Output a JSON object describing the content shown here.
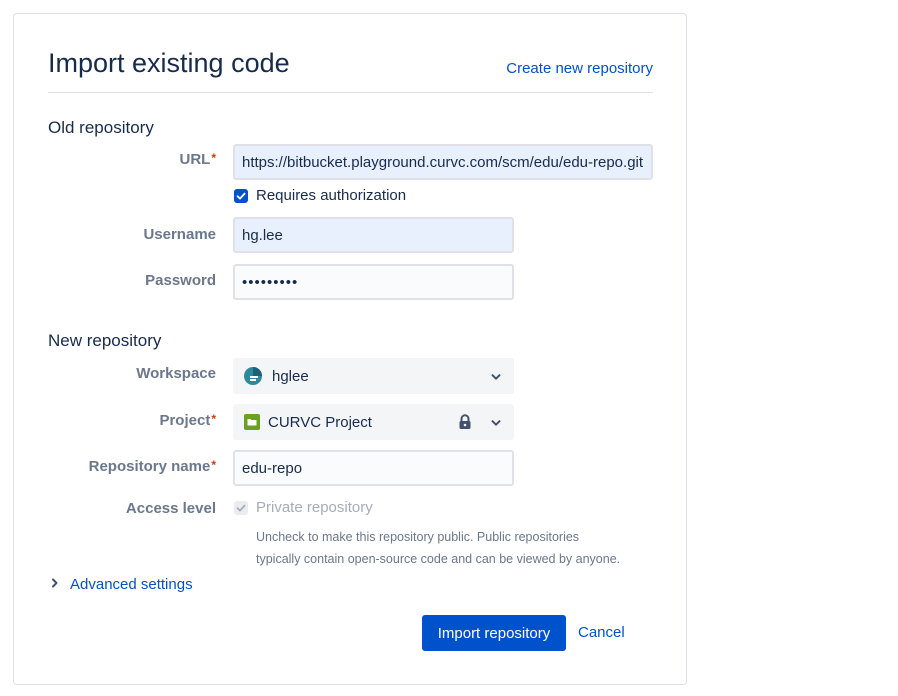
{
  "header": {
    "title": "Import existing code",
    "create_link": "Create new repository"
  },
  "old_repo": {
    "section_title": "Old repository",
    "url": {
      "label": "URL",
      "required_mark": "*",
      "value": "https://bitbucket.playground.curvc.com/scm/edu/edu-repo.git"
    },
    "requires_auth": {
      "label": "Requires authorization",
      "checked": true
    },
    "username": {
      "label": "Username",
      "value": "hg.lee"
    },
    "password": {
      "label": "Password",
      "value": "•••••••••"
    }
  },
  "new_repo": {
    "section_title": "New repository",
    "workspace": {
      "label": "Workspace",
      "value": "hglee",
      "icon": "workspace-avatar-icon"
    },
    "project": {
      "label": "Project",
      "required_mark": "*",
      "value": "CURVC Project",
      "icon": "folder-icon"
    },
    "repo_name": {
      "label": "Repository name",
      "required_mark": "*",
      "value": "edu-repo"
    },
    "access": {
      "label": "Access level",
      "checkbox_label": "Private repository",
      "checked": true,
      "help_line1": "Uncheck to make this repository public. Public repositories",
      "help_line2": "typically contain open-source code and can be viewed by anyone."
    }
  },
  "advanced": {
    "label": "Advanced settings"
  },
  "actions": {
    "import_label": "Import repository",
    "cancel_label": "Cancel"
  },
  "colors": {
    "primary": "#0052cc",
    "required": "#de350b",
    "label": "#6b778c",
    "text": "#172b4d"
  }
}
